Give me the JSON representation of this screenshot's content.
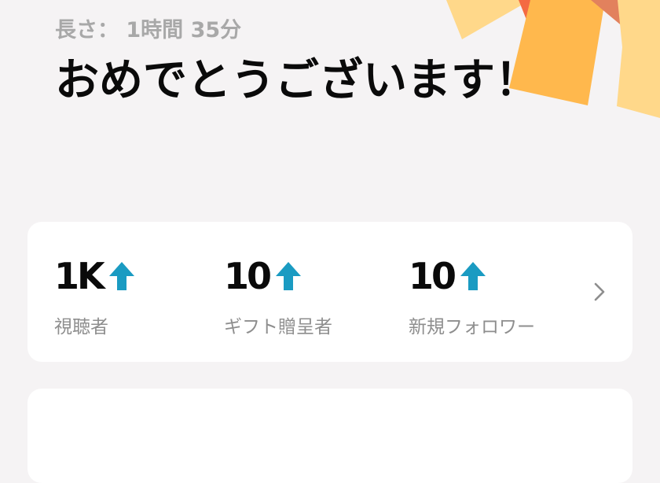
{
  "header": {
    "duration": "長さ： 1時間 35分",
    "title": "おめでとうございます！"
  },
  "stats": {
    "items": [
      {
        "value": "1K",
        "label": "視聴者",
        "trend_icon": "up-arrow-icon"
      },
      {
        "value": "10",
        "label": "ギフト贈呈者",
        "trend_icon": "up-arrow-icon"
      },
      {
        "value": "10",
        "label": "新規フォロワー",
        "trend_icon": "up-arrow-icon"
      }
    ],
    "more_icon": "chevron-right-icon"
  },
  "colors": {
    "background": "#f5f3f4",
    "card": "#ffffff",
    "accent_arrow": "#1a9bc2",
    "text_primary": "#0a0a0a",
    "text_secondary": "#8e8e8e",
    "confetti_yellow": "#ffd88a",
    "confetti_orange": "#ffb84d",
    "confetti_red": "#f0704a"
  }
}
